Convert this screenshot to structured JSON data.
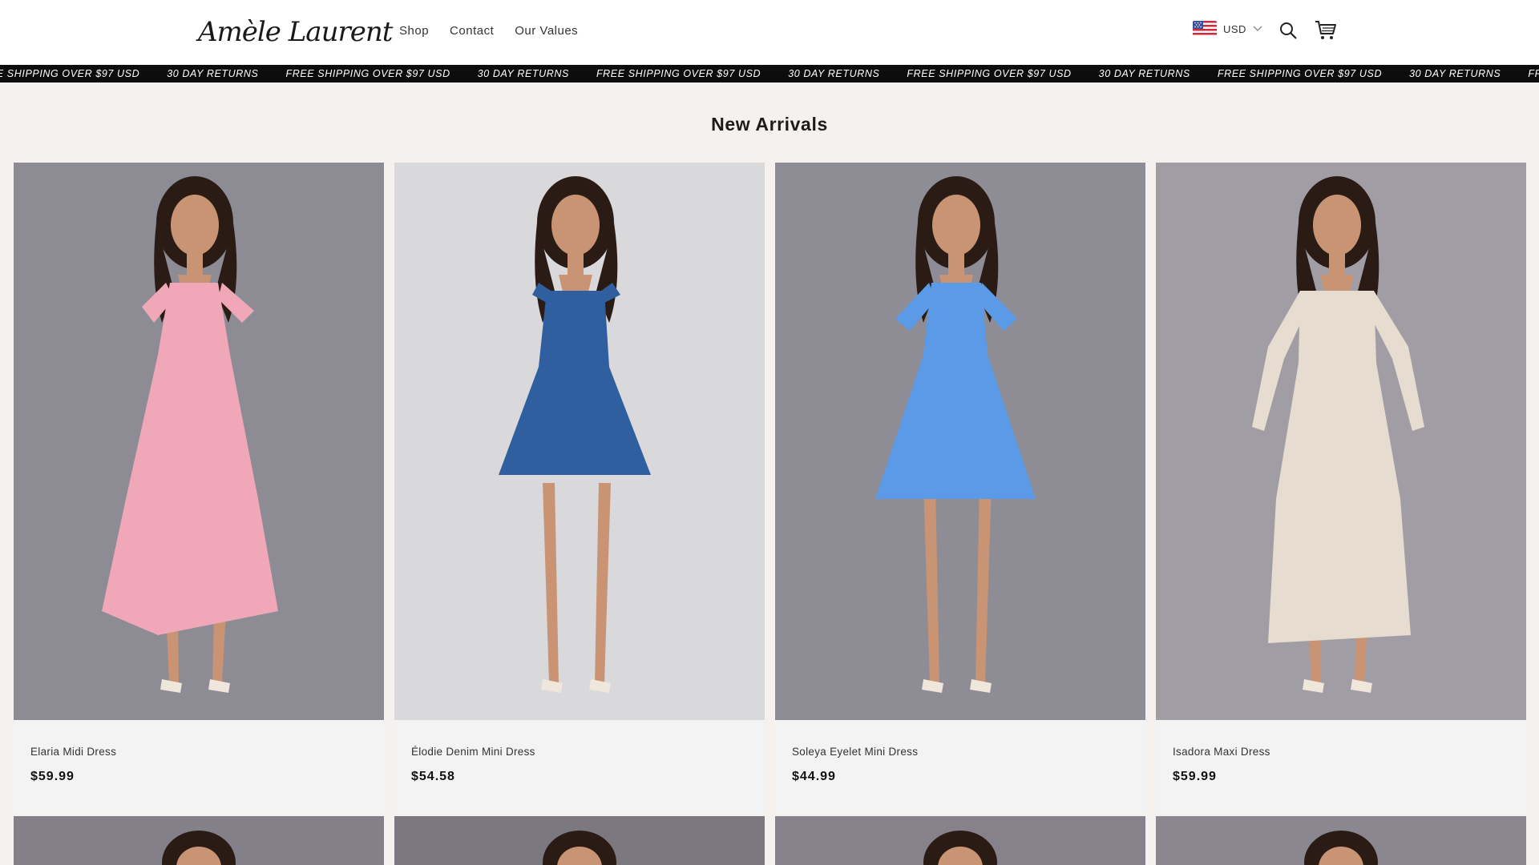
{
  "brand": {
    "logo_text": "Amèle Laurent"
  },
  "nav": {
    "items": [
      {
        "label": "Shop"
      },
      {
        "label": "Contact"
      },
      {
        "label": "Our Values"
      }
    ]
  },
  "header": {
    "currency_label": "USD",
    "icons": [
      "us-flag-icon",
      "chevron-down-icon",
      "search-icon",
      "cart-icon"
    ]
  },
  "announcement": {
    "items": [
      "FREE SHIPPING OVER $97 USD",
      "30 DAY RETURNS",
      "FREE SHIPPING OVER $97 USD",
      "30 DAY RETURNS",
      "FREE SHIPPING OVER $97 USD",
      "30 DAY RETURNS",
      "FREE SHIPPING OVER $97 USD",
      "30 DAY RETURNS",
      "FREE SHIPPING OVER $97 USD",
      "30 DAY RETURNS",
      "FREE SHIPPING OVER $97 USD"
    ]
  },
  "section": {
    "title": "New Arrivals"
  },
  "products": [
    {
      "name": "Elaria Midi Dress",
      "price": "$59.99",
      "dress_color": "#f0a8b8",
      "bg_color": "#8d8b94"
    },
    {
      "name": "Élodie Denim Mini Dress",
      "price": "$54.58",
      "dress_color": "#2f5f9e",
      "bg_color": "#d9d9db"
    },
    {
      "name": "Soleya Eyelet Mini Dress",
      "price": "$44.99",
      "dress_color": "#5a9ae6",
      "bg_color": "#8e8d95"
    },
    {
      "name": "Isadora Maxi Dress",
      "price": "$59.99",
      "dress_color": "#e6ddd0",
      "bg_color": "#a09ea4"
    }
  ],
  "products_row2_bg": [
    "#84808a",
    "#7c7880",
    "#85828b",
    "#8a8790"
  ]
}
